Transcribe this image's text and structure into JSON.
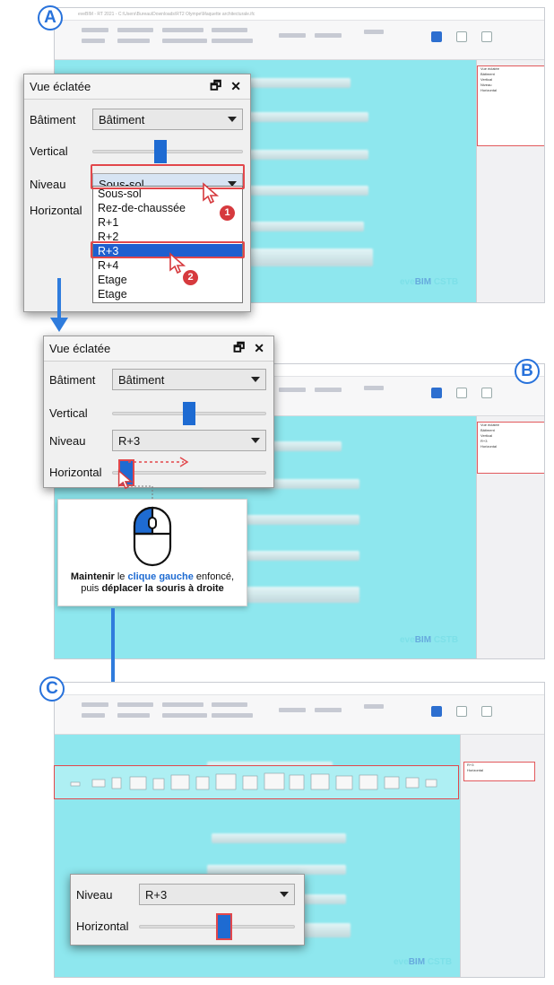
{
  "labels": {
    "a": "A",
    "b": "B",
    "c": "C"
  },
  "app": {
    "title": "eveBIM - RT 2021 - C:\\Users\\Bureau\\Downloads\\RT2 Olympe\\Maquette architecturale.ifc"
  },
  "watermark": {
    "brand1": "eve",
    "brand2": "BIM",
    "brand3": "CSTB"
  },
  "panel_a": {
    "title": "Vue éclatée",
    "batiment_label": "Bâtiment",
    "batiment_value": "Bâtiment",
    "vertical_label": "Vertical",
    "vertical_level": 0.45,
    "niveau_label": "Niveau",
    "niveau_value": "Sous-sol",
    "horizontal_label": "Horizontal",
    "options": [
      "Sous-sol",
      "Rez-de-chaussée",
      "R+1",
      "R+2",
      "R+3",
      "R+4",
      "Etage",
      "Etage"
    ],
    "selected_option": "R+3",
    "step1": "1",
    "step2": "2"
  },
  "panel_b": {
    "title": "Vue éclatée",
    "batiment_label": "Bâtiment",
    "batiment_value": "Bâtiment",
    "vertical_label": "Vertical",
    "vertical_level": 0.5,
    "niveau_label": "Niveau",
    "niveau_value": "R+3",
    "horizontal_label": "Horizontal",
    "horizontal_level": 0.05
  },
  "mouse_tip": {
    "part1": "Maintenir",
    "part2": " le ",
    "part3": "clique gauche",
    "part4": " enfoncé,",
    "part5": "puis ",
    "part6": "déplacer la souris à droite"
  },
  "panel_c": {
    "niveau_label": "Niveau",
    "niveau_value": "R+3",
    "horizontal_label": "Horizontal",
    "horizontal_level": 0.55
  },
  "colors": {
    "accent": "#1e6bd2",
    "highlight": "#e2474b",
    "viewport": "#8ee7ee"
  }
}
